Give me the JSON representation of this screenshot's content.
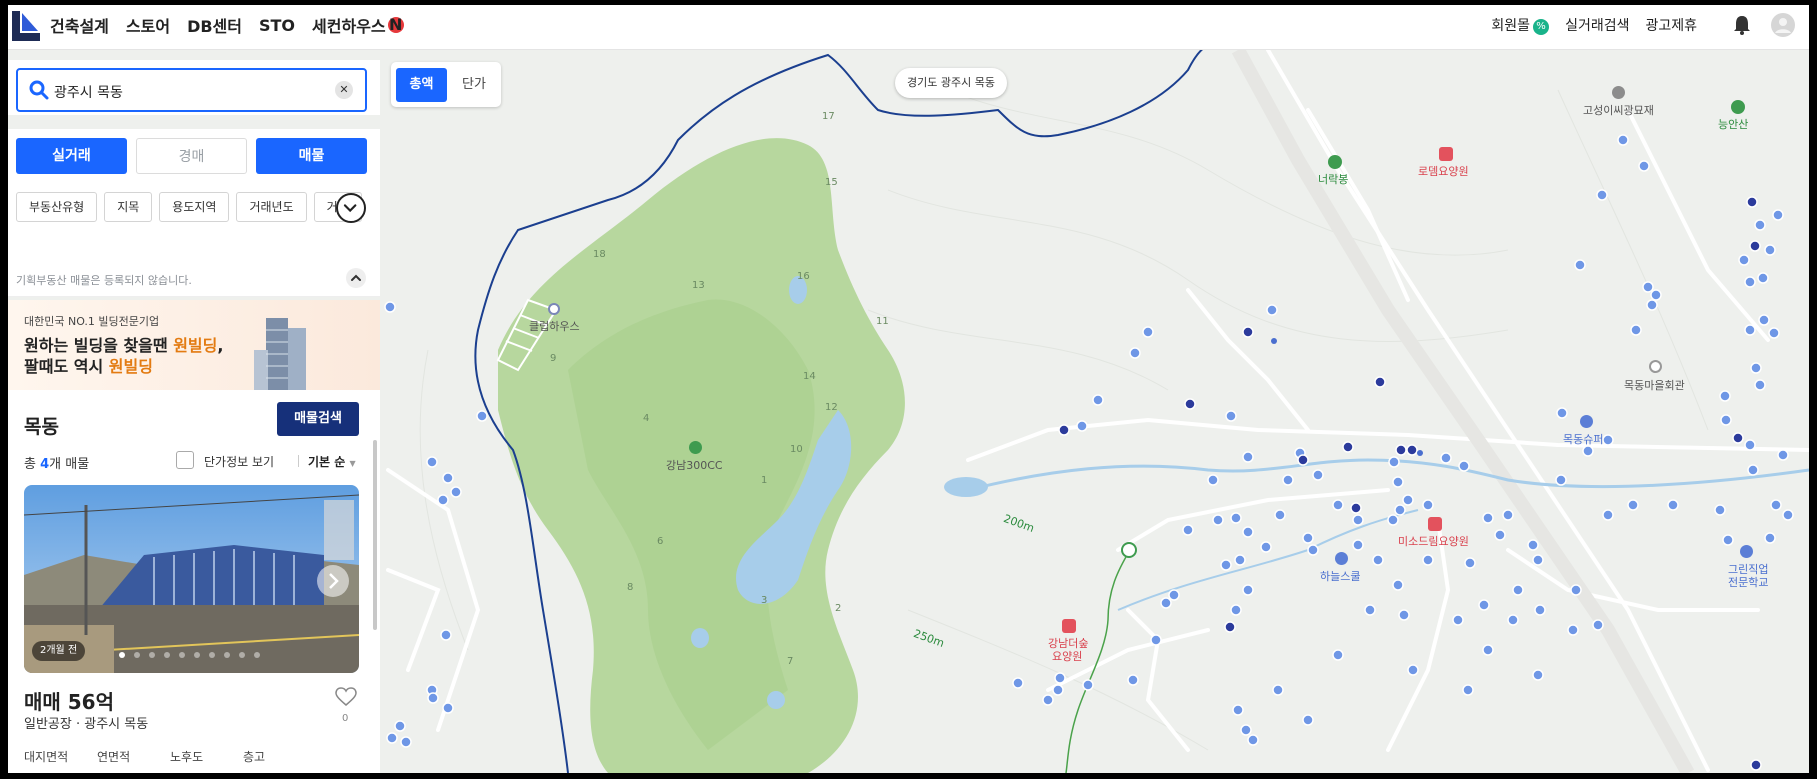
{
  "header": {
    "nav": [
      "건축설계",
      "스토어",
      "DB센터",
      "STO",
      "세컨하우스"
    ],
    "new_badge": "N",
    "links": {
      "member": "회원몰",
      "member_badge": "%",
      "deal_search": "실거래검색",
      "ad": "광고제휴"
    }
  },
  "search": {
    "value": "광주시 목동",
    "clear": "✕"
  },
  "deal_tabs": [
    {
      "label": "실거래",
      "active": true
    },
    {
      "label": "경매",
      "active": false
    },
    {
      "label": "매물",
      "active": true
    }
  ],
  "filters": [
    "부동산유형",
    "지목",
    "용도지역",
    "거래년도",
    "거래"
  ],
  "notice": "기획부동산 매물은 등록되지 않습니다.",
  "ad": {
    "line1": "대한민국 NO.1 빌딩전문기업",
    "line2a": "원하는 빌딩을 찾을땐 ",
    "line2b": "원빌딩",
    "line2c": ",",
    "line3a": "팔때도 역시 ",
    "line3b": "원빌딩"
  },
  "listing": {
    "area": "목동",
    "search_button": "매물검색",
    "total_prefix": "총 ",
    "total_count": "4",
    "total_suffix": "개 매물",
    "unit_price_toggle": "단가정보 보기",
    "sort": "기본 순",
    "item": {
      "age": "2개월 전",
      "price": "매매 56억",
      "sub": "일반공장 · 광주시 목동",
      "likes": "0",
      "attrs": [
        "대지면적",
        "연면적",
        "노후도",
        "층고"
      ]
    }
  },
  "price_toggle": {
    "on": "총액",
    "off": "단가"
  },
  "map": {
    "location_bubble": "경기도 광주시 목동",
    "labels": {
      "clubhouse": "클럽하우스",
      "golf": "강남300CC",
      "neorakbong": "너락봉",
      "gosung": "고성이씨광묘재",
      "nungan": "능안산",
      "rodem": "로뎀요양원",
      "mokdong_hall": "목동마을회관",
      "mokdong_super": "목동슈퍼",
      "misodream": "미소드림요양원",
      "haneul": "하늘스쿨",
      "gangnam_nursing": "강남더숲",
      "gangnam_nursing2": "요양원",
      "grin1": "그린직업",
      "grin2": "전문학교",
      "contour200": "200m",
      "contour250": "250m"
    },
    "holes": [
      "17",
      "15",
      "18",
      "16",
      "13",
      "11",
      "9",
      "14",
      "12",
      "4",
      "10",
      "1",
      "6",
      "8",
      "3",
      "2",
      "7"
    ]
  },
  "colors": {
    "accent": "#1a66ff",
    "navy": "#16307a",
    "golf_green": "#b7d79e"
  }
}
